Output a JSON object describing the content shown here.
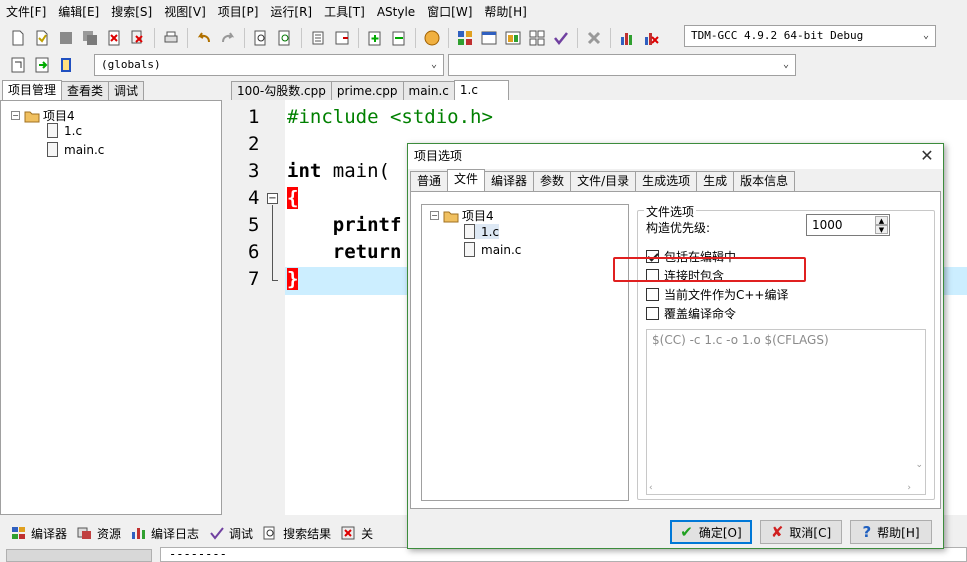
{
  "menu": [
    "文件[F]",
    "编辑[E]",
    "搜索[S]",
    "视图[V]",
    "项目[P]",
    "运行[R]",
    "工具[T]",
    "AStyle",
    "窗口[W]",
    "帮助[H]"
  ],
  "toolbar": {
    "compiler_select": "TDM-GCC 4.9.2 64-bit Debug",
    "scope_select": "(globals)"
  },
  "left_tabs": [
    "项目管理",
    "查看类",
    "调试"
  ],
  "project_tree": {
    "root": "项目4",
    "files": [
      "1.c",
      "main.c"
    ]
  },
  "editor_tabs": [
    "100-勾股数.cpp",
    "prime.cpp",
    "main.c",
    "1.c"
  ],
  "editor": {
    "line_numbers": [
      "1",
      "2",
      "3",
      "4",
      "5",
      "6",
      "7"
    ],
    "line1": "#include <stdio.h>",
    "line3_kw": "int",
    "line3_rest": " main(",
    "line4": "{",
    "line5": "    printf",
    "line6": "    return",
    "line7": "}"
  },
  "bottom_tabs": [
    "编译器",
    "资源",
    "编译日志",
    "调试",
    "搜索结果",
    "关"
  ],
  "status_text": "--------",
  "dialog": {
    "title": "项目选项",
    "tabs": [
      "普通",
      "文件",
      "编译器",
      "参数",
      "文件/目录",
      "生成选项",
      "生成",
      "版本信息"
    ],
    "tree_root": "项目4",
    "tree_files": [
      "1.c",
      "main.c"
    ],
    "group_label": "文件选项",
    "priority_label": "构造优先级:",
    "priority_value": "1000",
    "options": [
      {
        "label": "包括在编辑中",
        "checked": true
      },
      {
        "label": "连接时包含",
        "checked": false
      },
      {
        "label": "当前文件作为C++编译",
        "checked": false
      },
      {
        "label": "覆盖编译命令",
        "checked": false
      }
    ],
    "command": "$(CC) -c 1.c -o 1.o $(CFLAGS)",
    "ok": "确定[O]",
    "cancel": "取消[C]",
    "help": "帮助[H]"
  }
}
